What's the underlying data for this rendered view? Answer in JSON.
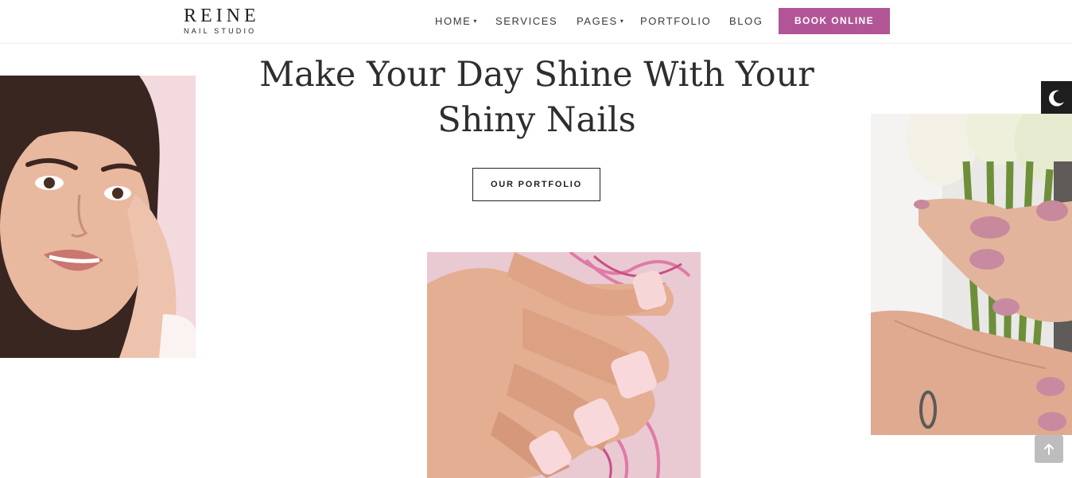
{
  "brand": {
    "name": "REINE",
    "tagline": "NAIL STUDIO"
  },
  "nav": {
    "items": [
      {
        "label": "HOME",
        "has_dropdown": true
      },
      {
        "label": "SERVICES",
        "has_dropdown": false
      },
      {
        "label": "PAGES",
        "has_dropdown": true
      },
      {
        "label": "PORTFOLIO",
        "has_dropdown": false
      },
      {
        "label": "BLOG",
        "has_dropdown": false
      }
    ],
    "cta_label": "BOOK ONLINE"
  },
  "hero": {
    "title_line1": "Make Your Day Shine With Your",
    "title_line2": "Shiny Nails",
    "button_label": "OUR PORTFOLIO"
  },
  "images": {
    "left": "woman-portrait-photo",
    "center": "manicured-hand-pink-yarn-photo",
    "right": "hands-holding-calla-lilies-photo"
  },
  "icons": {
    "dark_mode": "moon-icon",
    "scroll_top": "arrow-up-icon",
    "dropdown": "caret-down-icon"
  },
  "colors": {
    "accent": "#b25596",
    "text": "#2e2e2e",
    "dark_toggle_bg": "#1e1e1e",
    "scroll_btn_bg": "#bdbdbd"
  }
}
